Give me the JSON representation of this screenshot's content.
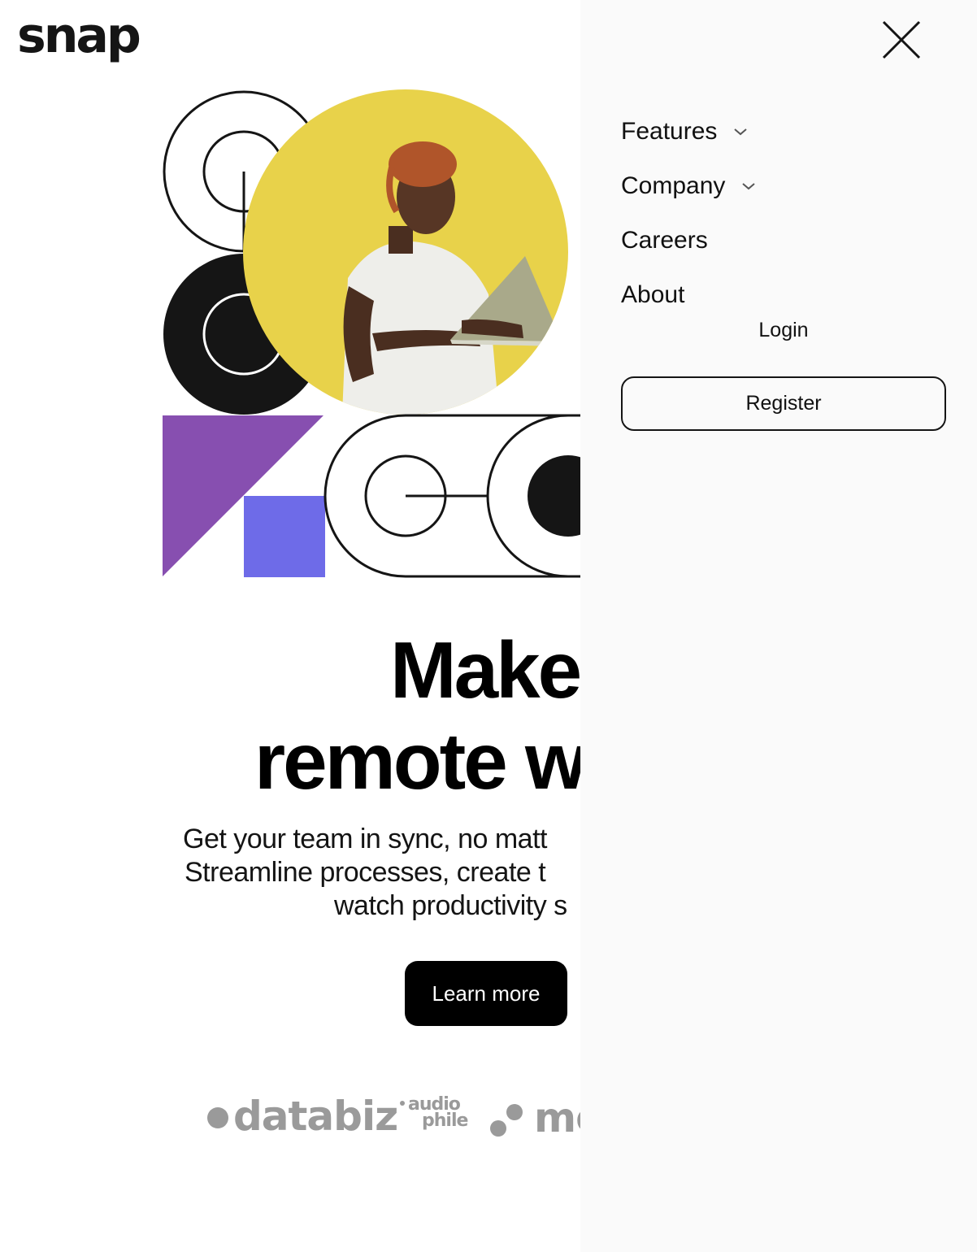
{
  "header": {
    "logo_text": "snap"
  },
  "hero": {
    "title_line1": "Make",
    "title_line2": "remote w",
    "desc_line1": "Get your team in sync, no matt",
    "desc_line2": "Streamline processes, create t",
    "desc_line3": "watch productivity s",
    "cta_label": "Learn more"
  },
  "clients": {
    "databiz": "databiz",
    "audiophile_top": "audio",
    "audiophile_bottom": "phile",
    "meet": "me"
  },
  "colors": {
    "menu_bg": "#fafafa",
    "hero_yellow": "#e8d24a",
    "purple": "#874fb0",
    "blue_square": "#6e6be8",
    "client_gray": "#9a9a9a"
  },
  "menu": {
    "close_icon": "close-icon",
    "items": [
      {
        "label": "Features",
        "has_dropdown": true
      },
      {
        "label": "Company",
        "has_dropdown": true
      },
      {
        "label": "Careers",
        "has_dropdown": false
      },
      {
        "label": "About",
        "has_dropdown": false
      }
    ],
    "login_label": "Login",
    "register_label": "Register"
  }
}
